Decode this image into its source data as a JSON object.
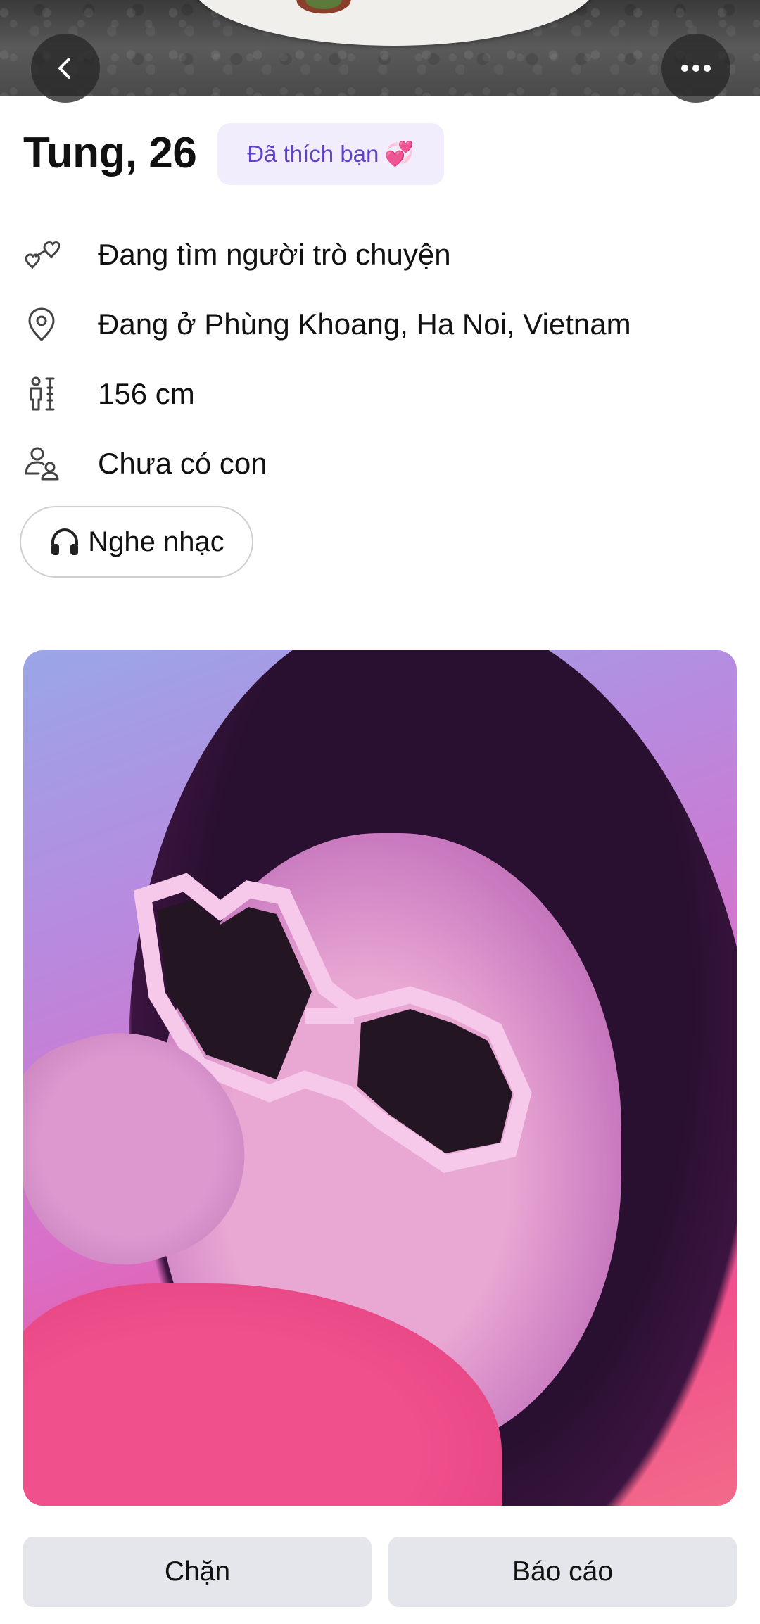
{
  "profile": {
    "name_age": "Tung, 26",
    "liked_badge": "Đã thích bạn",
    "liked_badge_icon": "two-hearts-emoji"
  },
  "info": [
    {
      "icon": "hearts-outline-icon",
      "text": "Đang tìm người trò chuyện"
    },
    {
      "icon": "location-pin-icon",
      "text": "Đang ở Phùng Khoang, Ha Noi, Vietnam"
    },
    {
      "icon": "height-icon",
      "text": "156 cm"
    },
    {
      "icon": "children-icon",
      "text": "Chưa có con"
    }
  ],
  "interests": [
    {
      "icon": "headphones-icon",
      "label": "Nghe nhạc"
    }
  ],
  "actions": {
    "block": "Chặn",
    "report": "Báo cáo"
  },
  "colors": {
    "badge_bg": "#f1edfd",
    "badge_text": "#5f42c6",
    "button_bg": "#e4e6eb"
  }
}
